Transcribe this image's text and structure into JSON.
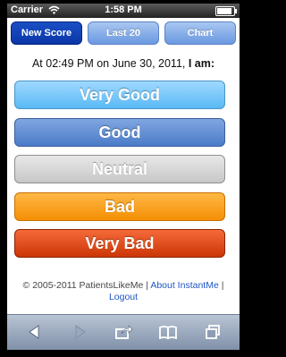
{
  "status_bar": {
    "carrier": "Carrier",
    "time": "1:58 PM"
  },
  "tabs": [
    {
      "label": "New Score",
      "active": true
    },
    {
      "label": "Last 20",
      "active": false
    },
    {
      "label": "Chart",
      "active": false
    }
  ],
  "prompt": {
    "text": "At 02:49 PM on June 30, 2011, ",
    "emphasis": "I am:"
  },
  "scores": [
    {
      "label": "Very Good",
      "color": "#5ab9f5"
    },
    {
      "label": "Good",
      "color": "#4c7cc8"
    },
    {
      "label": "Neutral",
      "color": "#c7c7c7"
    },
    {
      "label": "Bad",
      "color": "#f48f05"
    },
    {
      "label": "Very Bad",
      "color": "#cc3606"
    }
  ],
  "footer": {
    "copyright": "© 2005-2011 PatientsLikeMe | ",
    "about_link": "About InstantMe",
    "separator": " |",
    "logout_link": "Logout"
  },
  "toolbar": {
    "items": [
      "back-icon",
      "forward-icon",
      "share-icon",
      "bookmarks-icon",
      "pages-icon"
    ]
  }
}
